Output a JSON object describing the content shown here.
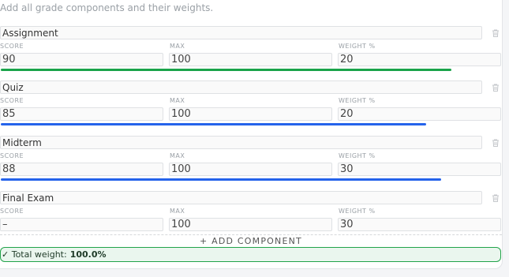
{
  "subtitle": "Add all grade components and their weights.",
  "labels": {
    "score": "SCORE",
    "max": "MAX",
    "weight": "WEIGHT %"
  },
  "components": [
    {
      "name": "Assignment",
      "score": "90",
      "max": "100",
      "weight": "20",
      "bar_color": "#1aa34a",
      "bar_fraction": 0.9
    },
    {
      "name": "Quiz",
      "score": "85",
      "max": "100",
      "weight": "20",
      "bar_color": "#2563eb",
      "bar_fraction": 0.85
    },
    {
      "name": "Midterm",
      "score": "88",
      "max": "100",
      "weight": "30",
      "bar_color": "#2563eb",
      "bar_fraction": 0.88
    },
    {
      "name": "Final Exam",
      "score": "–",
      "max": "100",
      "weight": "30",
      "bar_color": "",
      "bar_fraction": 0
    }
  ],
  "add_button": {
    "icon": "plus-icon",
    "label": "+  ADD COMPONENT"
  },
  "total": {
    "icon": "check-icon",
    "check": "✓",
    "label": "Total weight:",
    "value": "100.0%",
    "color": "#22a34a"
  }
}
